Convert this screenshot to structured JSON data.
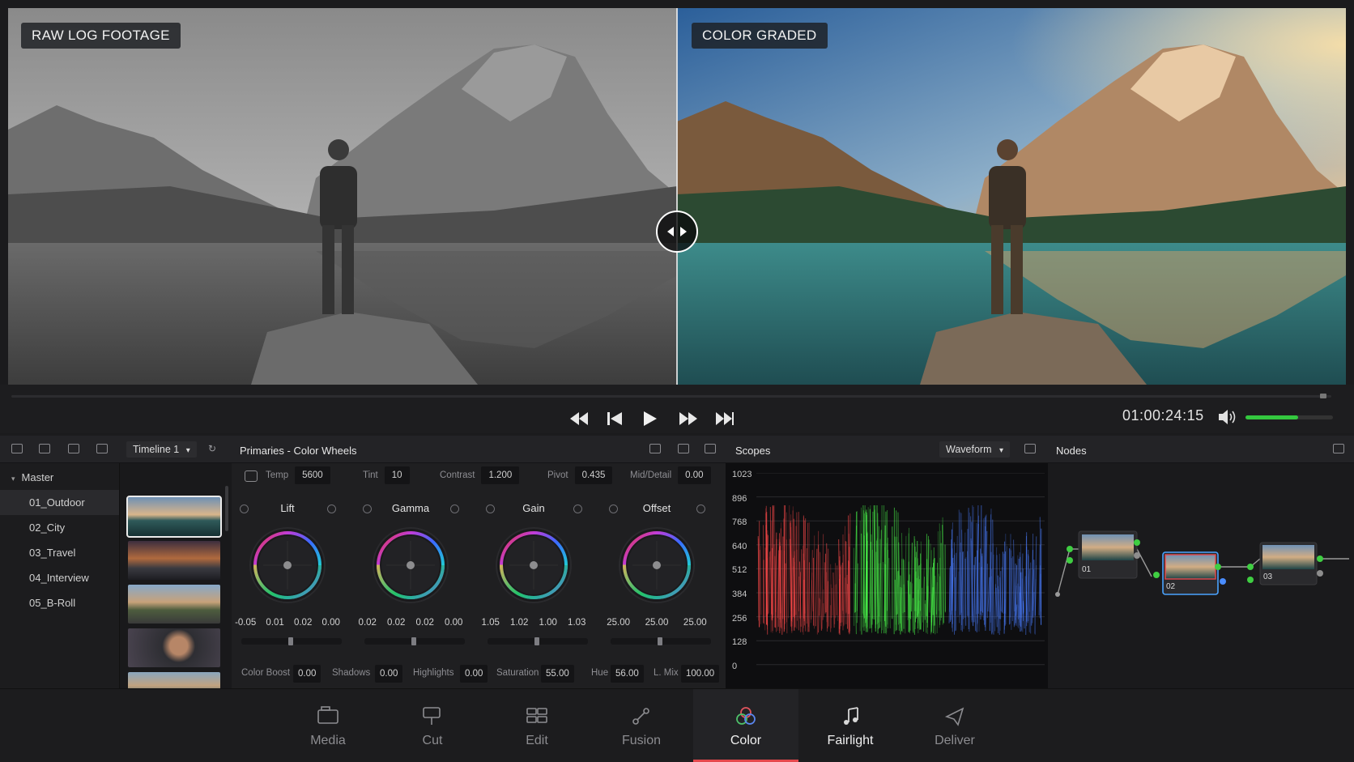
{
  "viewer": {
    "left_label": "RAW LOG FOOTAGE",
    "right_label": "COLOR GRADED"
  },
  "transport": {
    "timecode": "01:00:24:15",
    "volume": 0.6
  },
  "media_pool": {
    "timeline_select": "Timeline 1",
    "bins": [
      {
        "label": "Master"
      },
      {
        "label": "01_Outdoor"
      },
      {
        "label": "02_City"
      },
      {
        "label": "03_Travel"
      },
      {
        "label": "04_Interview"
      },
      {
        "label": "05_B-Roll"
      }
    ],
    "selected_bin": "01_Outdoor"
  },
  "primaries": {
    "title": "Primaries - Color Wheels",
    "params": [
      {
        "label": "Temp",
        "value": "5600"
      },
      {
        "label": "Tint",
        "value": "10"
      },
      {
        "label": "Contrast",
        "value": "1.200"
      },
      {
        "label": "Pivot",
        "value": "0.435"
      },
      {
        "label": "Mid/Detail",
        "value": "0.00"
      }
    ],
    "wheels": [
      {
        "name": "Lift",
        "values": [
          "-0.05",
          "0.01",
          "0.02",
          "0.00"
        ]
      },
      {
        "name": "Gamma",
        "values": [
          "0.02",
          "0.02",
          "0.02",
          "0.00"
        ]
      },
      {
        "name": "Gain",
        "values": [
          "1.05",
          "1.02",
          "1.00",
          "1.03"
        ]
      },
      {
        "name": "Offset",
        "values": [
          "25.00",
          "25.00",
          "25.00"
        ]
      }
    ],
    "bottom_params": [
      {
        "label": "Color Boost",
        "value": "0.00"
      },
      {
        "label": "Shadows",
        "value": "0.00"
      },
      {
        "label": "Highlights",
        "value": "0.00"
      },
      {
        "label": "Saturation",
        "value": "55.00"
      },
      {
        "label": "Hue",
        "value": "56.00"
      },
      {
        "label": "L. Mix",
        "value": "100.00"
      }
    ]
  },
  "scopes": {
    "title": "Scopes",
    "mode": "Waveform",
    "y_ticks": [
      "1023",
      "896",
      "768",
      "640",
      "512",
      "384",
      "256",
      "128",
      "0"
    ]
  },
  "nodes": {
    "title": "Nodes",
    "items": [
      {
        "label": "01"
      },
      {
        "label": "02"
      },
      {
        "label": "03"
      }
    ]
  },
  "nav": {
    "items": [
      {
        "label": "Media",
        "icon": "media-icon"
      },
      {
        "label": "Cut",
        "icon": "cut-icon"
      },
      {
        "label": "Edit",
        "icon": "edit-icon"
      },
      {
        "label": "Fusion",
        "icon": "fusion-icon"
      },
      {
        "label": "Color",
        "icon": "color-icon"
      },
      {
        "label": "Fairlight",
        "icon": "fairlight-icon"
      },
      {
        "label": "Deliver",
        "icon": "deliver-icon"
      }
    ],
    "active": "Color",
    "accent": "#e5484d"
  },
  "colors": {
    "waveform_red": "#ff4a4a",
    "waveform_green": "#4cff4c",
    "waveform_blue": "#4a7dff",
    "volume_green": "#34c83f"
  }
}
